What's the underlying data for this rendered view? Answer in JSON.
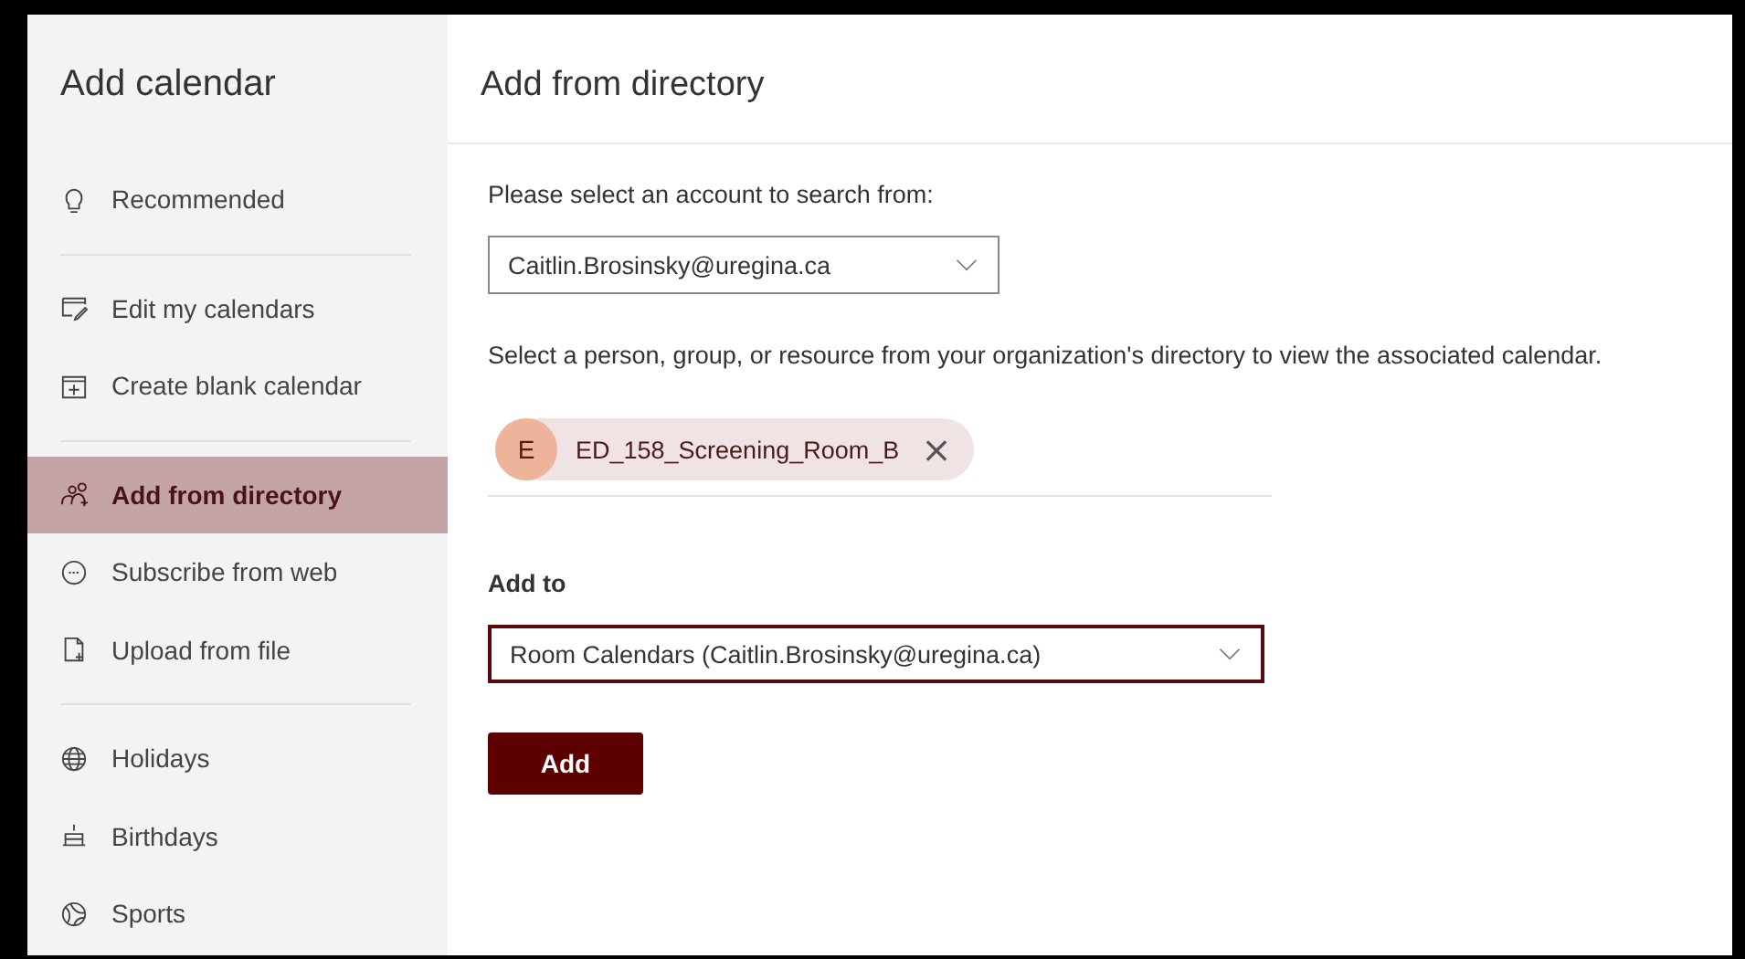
{
  "sidebar": {
    "title": "Add calendar",
    "groups": [
      [
        {
          "label": "Recommended",
          "selected": false
        }
      ],
      [
        {
          "label": "Edit my calendars",
          "selected": false
        },
        {
          "label": "Create blank calendar",
          "selected": false
        }
      ],
      [
        {
          "label": "Add from directory",
          "selected": true
        },
        {
          "label": "Subscribe from web",
          "selected": false
        },
        {
          "label": "Upload from file",
          "selected": false
        }
      ],
      [
        {
          "label": "Holidays",
          "selected": false
        },
        {
          "label": "Birthdays",
          "selected": false
        },
        {
          "label": "Sports",
          "selected": false
        }
      ]
    ]
  },
  "main": {
    "title": "Add from directory",
    "account_label": "Please select an account to search from:",
    "account_value": "Caitlin.Brosinsky@uregina.ca",
    "instructions": "Select a person, group, or resource from your organization's directory to view the associated calendar.",
    "selected_people": [
      {
        "initial": "E",
        "name": "ED_158_Screening_Room_B",
        "remove": "×"
      }
    ],
    "add_to_label": "Add to",
    "add_to_value": "Room Calendars (Caitlin.Brosinsky@uregina.ca)",
    "add_button": "Add"
  }
}
